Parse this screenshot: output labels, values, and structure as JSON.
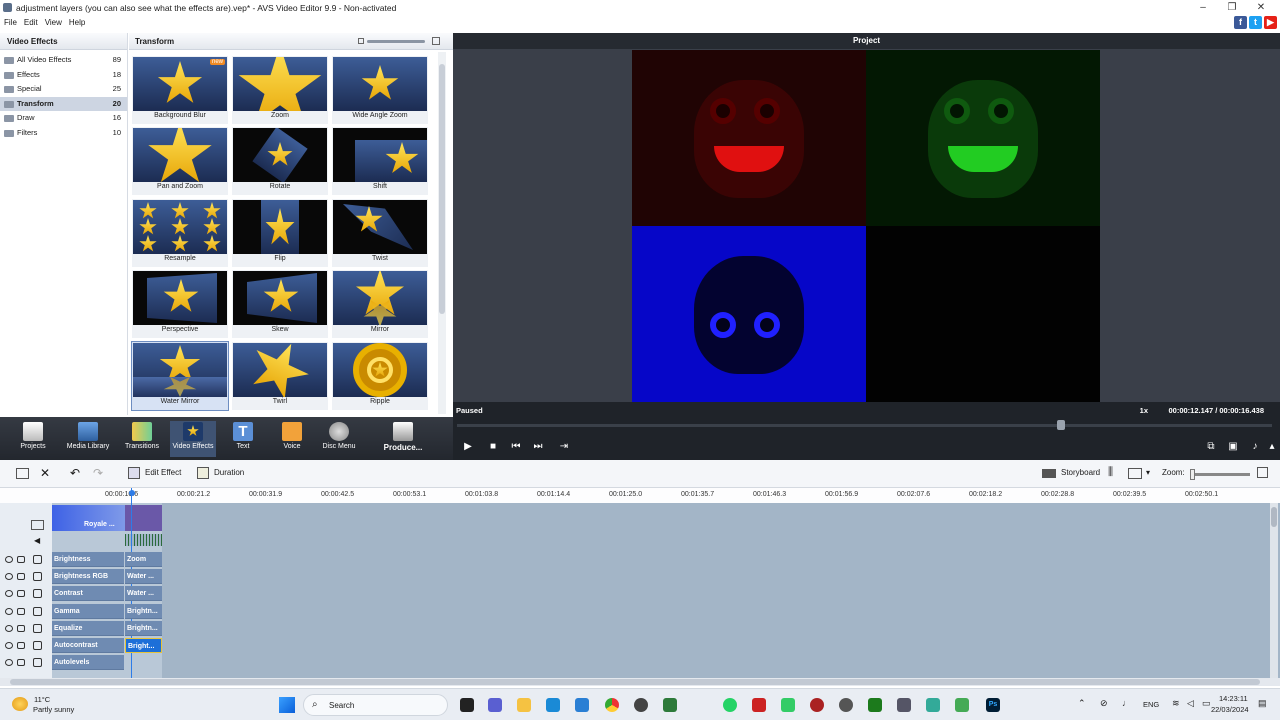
{
  "window": {
    "title": "adjustment layers (you can also see what the effects are).vep* - AVS Video Editor 9.9 - Non-activated",
    "minimize": "–",
    "maximize": "❐",
    "close": "✕"
  },
  "menu": [
    "File",
    "Edit",
    "View",
    "Help"
  ],
  "social": [
    "f",
    "t",
    "▶"
  ],
  "left_panel": {
    "title": "Video Effects",
    "categories": [
      {
        "label": "All Video Effects",
        "count": "89"
      },
      {
        "label": "Effects",
        "count": "18"
      },
      {
        "label": "Special",
        "count": "25"
      },
      {
        "label": "Transform",
        "count": "20"
      },
      {
        "label": "Draw",
        "count": "16"
      },
      {
        "label": "Filters",
        "count": "10"
      }
    ]
  },
  "effects_panel": {
    "title": "Transform",
    "new_badge": "new",
    "effects": [
      {
        "label": "Background Blur"
      },
      {
        "label": "Zoom"
      },
      {
        "label": "Wide Angle Zoom"
      },
      {
        "label": "Pan and Zoom"
      },
      {
        "label": "Rotate"
      },
      {
        "label": "Shift"
      },
      {
        "label": "Resample"
      },
      {
        "label": "Flip"
      },
      {
        "label": "Twist"
      },
      {
        "label": "Perspective"
      },
      {
        "label": "Skew"
      },
      {
        "label": "Mirror"
      },
      {
        "label": "Water Mirror"
      },
      {
        "label": "Twirl"
      },
      {
        "label": "Ripple"
      }
    ]
  },
  "preview": {
    "title": "Project",
    "status": "Paused",
    "speed": "1x",
    "time": "00:00:12.147 / 00:00:16.438"
  },
  "toolbar": {
    "items": [
      {
        "label": "Projects"
      },
      {
        "label": "Media Library"
      },
      {
        "label": "Transitions"
      },
      {
        "label": "Video Effects"
      },
      {
        "label": "Text"
      },
      {
        "label": "Voice"
      },
      {
        "label": "Disc Menu"
      },
      {
        "label": "Produce..."
      }
    ]
  },
  "edit_toolbar": {
    "edit_effect": "Edit Effect",
    "duration": "Duration",
    "storyboard": "Storyboard",
    "zoom": "Zoom:"
  },
  "ruler": [
    "00:00:10.6",
    "00:00:21.2",
    "00:00:31.9",
    "00:00:42.5",
    "00:00:53.1",
    "00:01:03.8",
    "00:01:14.4",
    "00:01:25.0",
    "00:01:35.7",
    "00:01:46.3",
    "00:01:56.9",
    "00:02:07.6",
    "00:02:18.2",
    "00:02:28.8",
    "00:02:39.5",
    "00:02:50.1"
  ],
  "timeline": {
    "video_clip": "Royale ...",
    "tracks": [
      {
        "a": "Brightness",
        "b": "Zoom"
      },
      {
        "a": "Brightness RGB",
        "b": "Water ..."
      },
      {
        "a": "Contrast",
        "b": "Water ..."
      },
      {
        "a": "Gamma",
        "b": "Brightn..."
      },
      {
        "a": "Equalize",
        "b": "Brightn..."
      },
      {
        "a": "Autocontrast",
        "b": "Bright..."
      },
      {
        "a": "Autolevels",
        "b": ""
      }
    ]
  },
  "taskbar": {
    "weather_temp": "11°C",
    "weather_desc": "Partly sunny",
    "search": "Search",
    "lang": "ENG",
    "time": "14:23:11",
    "date": "22/03/2024"
  }
}
